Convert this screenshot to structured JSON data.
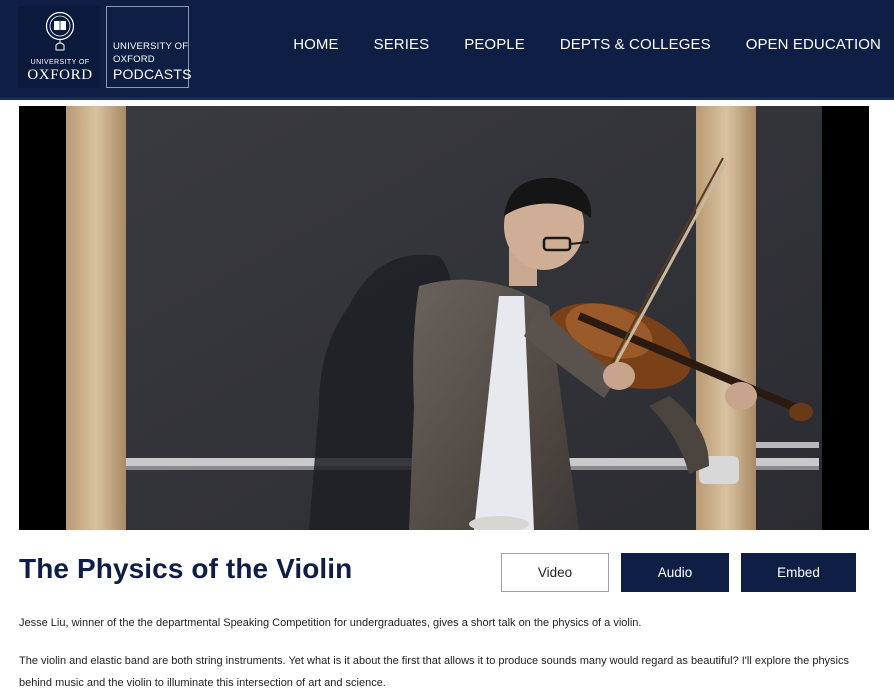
{
  "header": {
    "oxford_logo": {
      "university_line": "UNIVERSITY OF",
      "name": "OXFORD"
    },
    "podcasts_logo": {
      "line1": "UNIVERSITY OF",
      "line2": "OXFORD",
      "line3": "PODCASTS"
    },
    "nav": [
      "HOME",
      "SERIES",
      "PEOPLE",
      "DEPTS & COLLEGES",
      "OPEN EDUCATION"
    ]
  },
  "video": {
    "description": "video frame: a person playing a violin in front of a blackboard"
  },
  "episode": {
    "title": "The Physics of the Violin",
    "buttons": {
      "video": "Video",
      "audio": "Audio",
      "embed": "Embed"
    },
    "summary": "Jesse Liu, winner of the the departmental Speaking Competition for undergraduates, gives a short talk on the physics of a violin.",
    "description": "The violin and elastic band are both string instruments. Yet what is it about the first that allows it to produce sounds many would regard as beautiful? I'll explore the physics behind music and the violin to illuminate this intersection of art and science."
  },
  "colors": {
    "brand_navy": "#0f1e44",
    "text": "#222222"
  }
}
